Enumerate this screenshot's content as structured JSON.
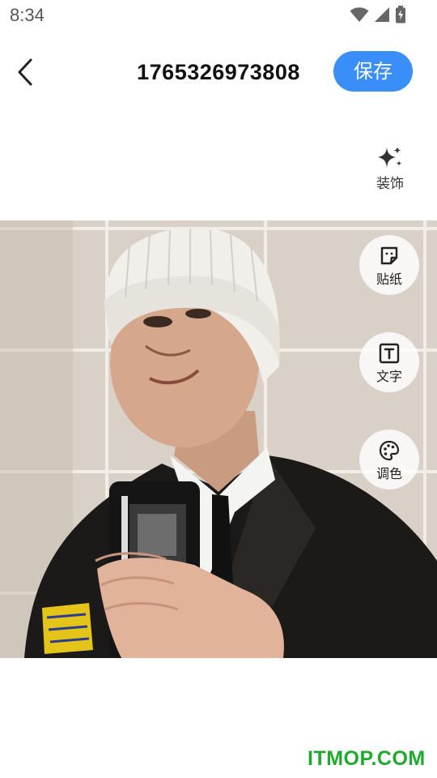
{
  "status_bar": {
    "time": "8:34",
    "icons": [
      "wifi-icon",
      "cell-signal-icon",
      "battery-charging-icon"
    ]
  },
  "header": {
    "back_icon": "chevron-left-icon",
    "title": "1765326973808",
    "save_label": "保存",
    "accent_color": "#3a8ef8"
  },
  "decorate": {
    "icon": "sparkle-icon",
    "label": "装饰"
  },
  "tools": [
    {
      "icon": "sticker-icon",
      "label": "贴纸"
    },
    {
      "icon": "text-icon",
      "label": "文字"
    },
    {
      "icon": "palette-icon",
      "label": "调色"
    }
  ],
  "watermark": {
    "text": "ITMOP.COM",
    "color": "#1faa2e"
  }
}
